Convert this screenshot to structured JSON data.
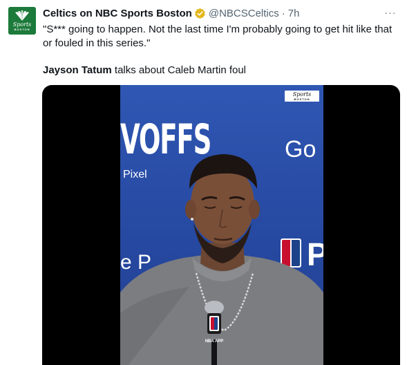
{
  "account": {
    "display_name": "Celtics on NBC Sports Boston",
    "handle": "@NBCSCeltics",
    "separator": "·",
    "time": "7h",
    "avatar_brand": "Sports",
    "avatar_city": "BOSTON",
    "verified_icon": "gold-verified-badge"
  },
  "tweet": {
    "quote_text": "\"S*** going to happen. Not the last time I'm probably going to get hit like that or fouled in this series.\"",
    "speaker_name": "Jayson Tatum",
    "speaker_rest": " talks about Caleb Martin foul"
  },
  "menu": {
    "more_label": "···"
  },
  "video": {
    "watermark_brand": "Sports",
    "watermark_city": "BOSTON",
    "backdrop_text_left": "VOFFS",
    "backdrop_text_pixel": "Pixel",
    "backdrop_text_right": "Go",
    "backdrop_text_lower": "e P",
    "backdrop_text_p": "P",
    "mic_label": "NBA APP"
  },
  "colors": {
    "brand_green": "#1c7a3a",
    "backdrop_blue": "#2a4fa8",
    "verified_gold": "#e2b719",
    "muted_text": "#536471"
  }
}
